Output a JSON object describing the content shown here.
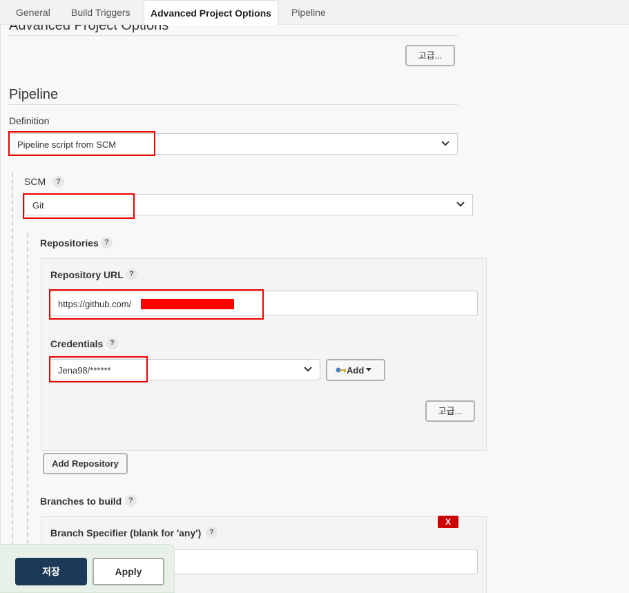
{
  "tabs": [
    {
      "label": "General",
      "active": false
    },
    {
      "label": "Build Triggers",
      "active": false
    },
    {
      "label": "Advanced Project Options",
      "active": true
    },
    {
      "label": "Pipeline",
      "active": false
    }
  ],
  "advanced": {
    "heading": "Advanced Project Options",
    "advanced_button": "고급..."
  },
  "pipeline": {
    "heading": "Pipeline",
    "definition_label": "Definition",
    "definition_value": "Pipeline script from SCM",
    "scm_label": "SCM",
    "scm_value": "Git",
    "help_glyph": "?"
  },
  "repositories": {
    "label": "Repositories",
    "repo_url_label": "Repository URL",
    "repo_url_value": "https://github.com/",
    "credentials_label": "Credentials",
    "credentials_value": "Jena98/******",
    "add_button": "Add",
    "advanced_button": "고급...",
    "add_repository_button": "Add Repository"
  },
  "branches": {
    "label": "Branches to build",
    "specifier_label": "Branch Specifier (blank for 'any')",
    "delete_button": "X"
  },
  "footer": {
    "save_label": "저장",
    "apply_label": "Apply"
  },
  "colors": {
    "highlight": "#e00000",
    "save_bg": "#1c3a57",
    "redacted": "#ff0000"
  },
  "icons": [
    "chevron-down-icon",
    "key-icon",
    "caret-down-icon",
    "help-icon"
  ]
}
